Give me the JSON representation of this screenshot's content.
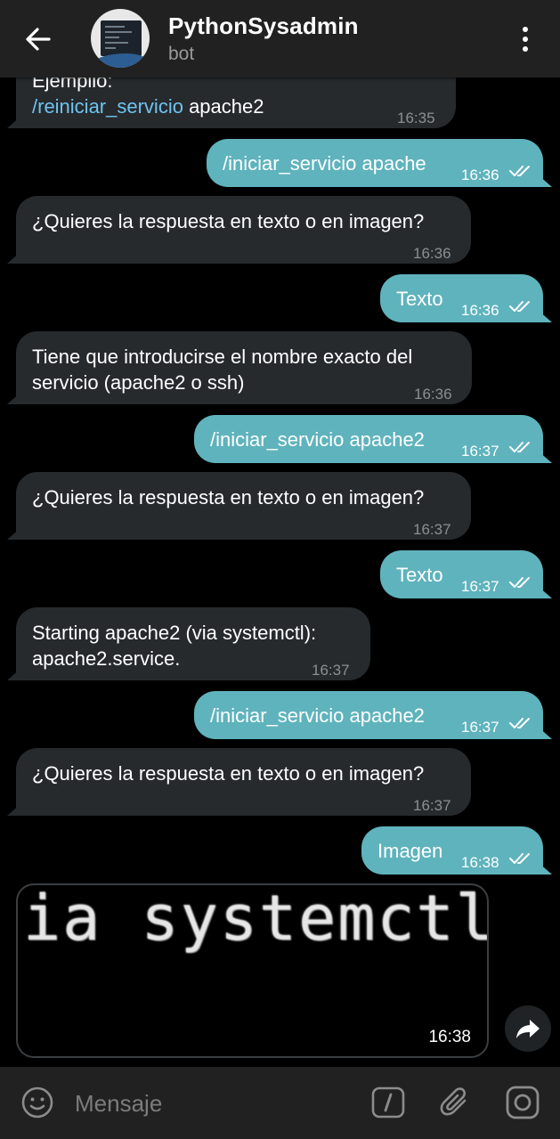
{
  "header": {
    "title": "PythonSysadmin",
    "subtitle": "bot"
  },
  "messages": [
    {
      "dir": "in",
      "parts": [
        {
          "t": "Ejemplio:"
        }
      ],
      "line2": [
        {
          "t": "/reiniciar_servicio",
          "cmd": true
        },
        {
          "t": " apache2"
        }
      ],
      "time": "16:35"
    },
    {
      "dir": "out",
      "parts": [
        {
          "t": "/iniciar_servicio apache",
          "cmd": true
        }
      ],
      "time": "16:36"
    },
    {
      "dir": "in",
      "parts": [
        {
          "t": "¿Quieres la respuesta en texto o en imagen?"
        }
      ],
      "time": "16:36"
    },
    {
      "dir": "out",
      "parts": [
        {
          "t": "Texto"
        }
      ],
      "time": "16:36"
    },
    {
      "dir": "in",
      "parts": [
        {
          "t": "Tiene que introducirse el nombre exacto del"
        }
      ],
      "line2": [
        {
          "t": "servicio (apache2 o ssh)"
        }
      ],
      "time": "16:36"
    },
    {
      "dir": "out",
      "parts": [
        {
          "t": "/iniciar_servicio",
          "cmd": true
        },
        {
          "t": " apache2"
        }
      ],
      "time": "16:37"
    },
    {
      "dir": "in",
      "parts": [
        {
          "t": "¿Quieres la respuesta en texto o en imagen?"
        }
      ],
      "time": "16:37"
    },
    {
      "dir": "out",
      "parts": [
        {
          "t": "Texto"
        }
      ],
      "time": "16:37"
    },
    {
      "dir": "in",
      "parts": [
        {
          "t": "Starting apache2 (via systemctl):"
        }
      ],
      "line2": [
        {
          "t": "apache2.service."
        }
      ],
      "time": "16:37"
    },
    {
      "dir": "out",
      "parts": [
        {
          "t": "/iniciar_servicio",
          "cmd": true
        },
        {
          "t": " apache2"
        }
      ],
      "time": "16:37"
    },
    {
      "dir": "in",
      "parts": [
        {
          "t": "¿Quieres la respuesta en texto o en imagen?"
        }
      ],
      "time": "16:37"
    },
    {
      "dir": "out",
      "parts": [
        {
          "t": "Imagen"
        }
      ],
      "time": "16:38"
    }
  ],
  "image_message": {
    "image_text": "ia systemctl",
    "time": "16:38"
  },
  "input": {
    "placeholder": "Mensaje"
  },
  "colors": {
    "incoming_bubble": "#262a2d",
    "outgoing_bubble": "#5fb3bd",
    "command_link": "#6fc3f0"
  },
  "icons": {
    "back": "arrow-left-icon",
    "menu": "more-vertical-icon",
    "share": "share-arrow-icon",
    "emoji": "emoji-icon",
    "command": "slash-command-icon",
    "attach": "paperclip-icon",
    "camera": "instagram-camera-icon"
  }
}
